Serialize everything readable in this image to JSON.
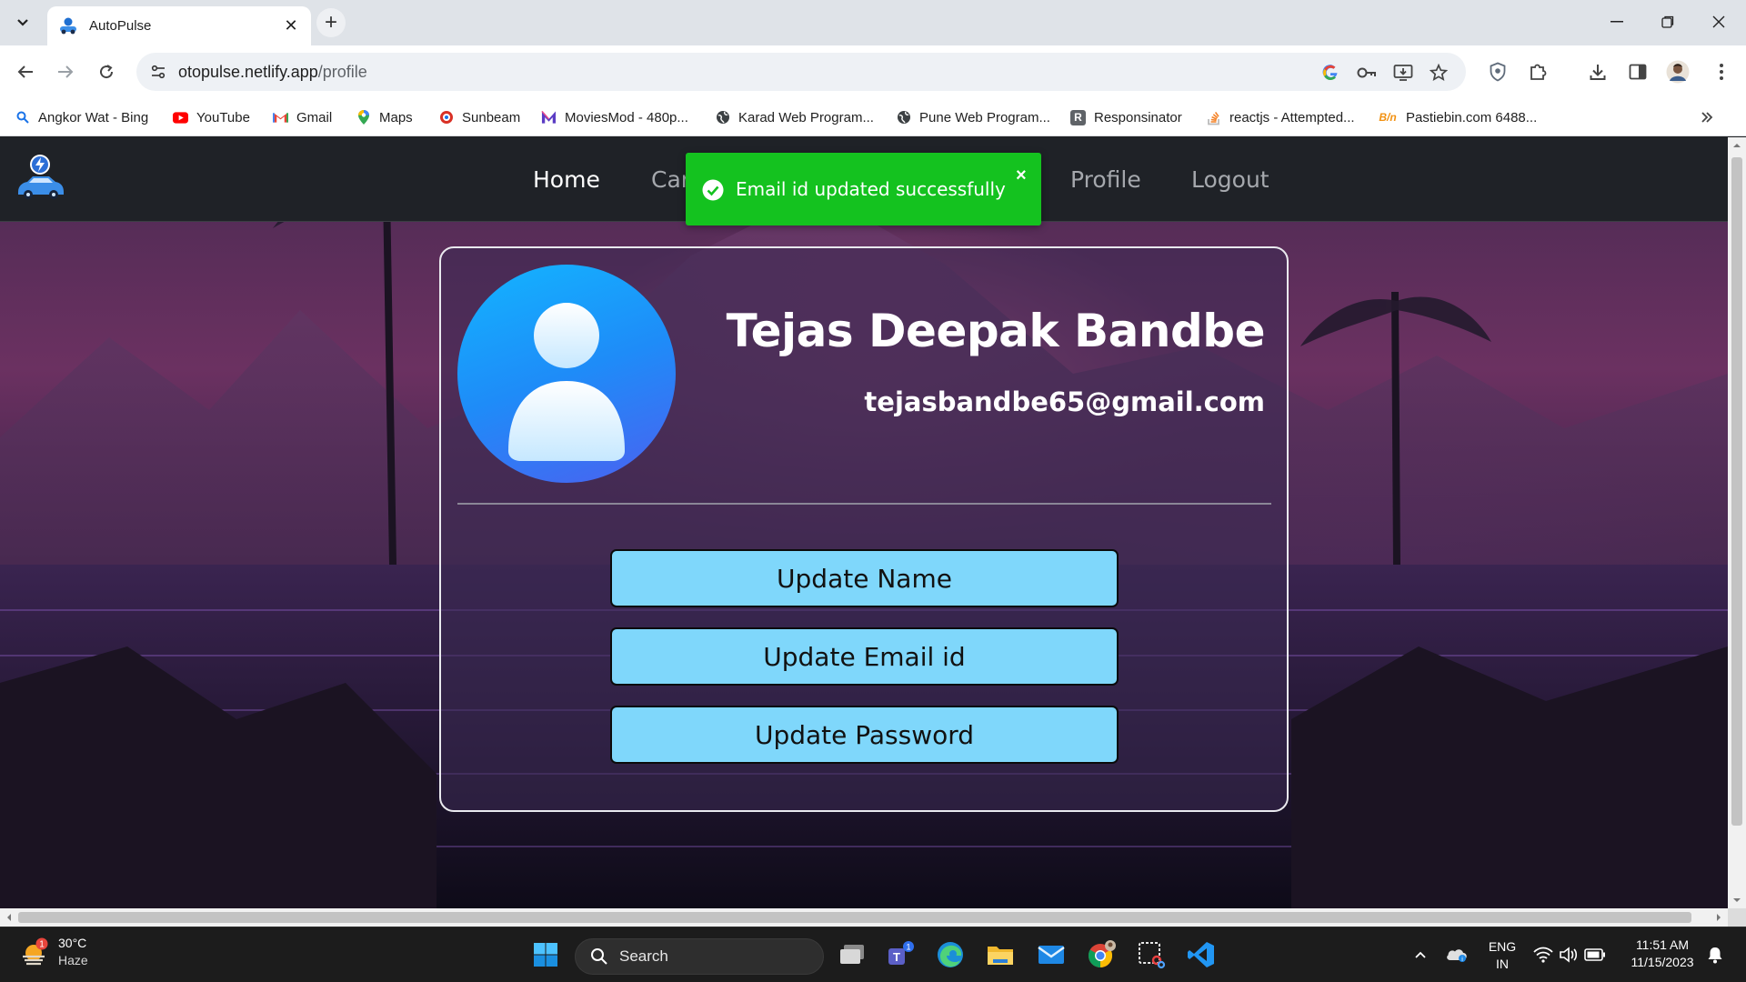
{
  "browser": {
    "tab_title": "AutoPulse",
    "url_host": "otopulse.netlify.app",
    "url_path": "/profile",
    "bookmarks": [
      {
        "label": "Angkor Wat - Bing",
        "icon": "bing-search-icon",
        "color": "#1a73e8"
      },
      {
        "label": "YouTube",
        "icon": "youtube-icon",
        "color": "#ff0000"
      },
      {
        "label": "Gmail",
        "icon": "gmail-icon",
        "color": "#ea4335"
      },
      {
        "label": "Maps",
        "icon": "maps-pin-icon",
        "color": "#34a853"
      },
      {
        "label": "Sunbeam",
        "icon": "sunbeam-icon",
        "color": "#d93025"
      },
      {
        "label": "MoviesMod - 480p...",
        "icon": "moviesmod-icon",
        "color": "#5b3cc4"
      },
      {
        "label": "Karad Web Program...",
        "icon": "globe-icon",
        "color": "#3c4043"
      },
      {
        "label": "Pune Web Program...",
        "icon": "globe-icon",
        "color": "#3c4043"
      },
      {
        "label": "Responsinator",
        "icon": "responsinator-icon",
        "color": "#5f6368"
      },
      {
        "label": "reactjs - Attempted...",
        "icon": "stackoverflow-icon",
        "color": "#f48024"
      },
      {
        "label": "Pastiebin.com 6488...",
        "icon": "pastiebin-icon",
        "color": "#f29111"
      }
    ]
  },
  "site": {
    "nav": [
      {
        "label": "Home",
        "active": true
      },
      {
        "label": "Car",
        "active": false
      },
      {
        "label": "Profile",
        "active": false
      },
      {
        "label": "Logout",
        "active": false
      }
    ],
    "toast": {
      "message": "Email id updated successfully",
      "close": "×",
      "color": "#14c21f"
    }
  },
  "profile": {
    "name": "Tejas Deepak Bandbe",
    "email": "tejasbandbe65@gmail.com",
    "actions": [
      "Update Name",
      "Update Email id",
      "Update Password"
    ],
    "button_color": "#7fd7fb"
  },
  "taskbar": {
    "weather_temp": "30°C",
    "weather_cond": "Haze",
    "weather_badge": "1",
    "search_label": "Search",
    "teams_badge": "1",
    "lang_line1": "ENG",
    "lang_line2": "IN",
    "time": "11:51 AM",
    "date": "11/15/2023"
  }
}
